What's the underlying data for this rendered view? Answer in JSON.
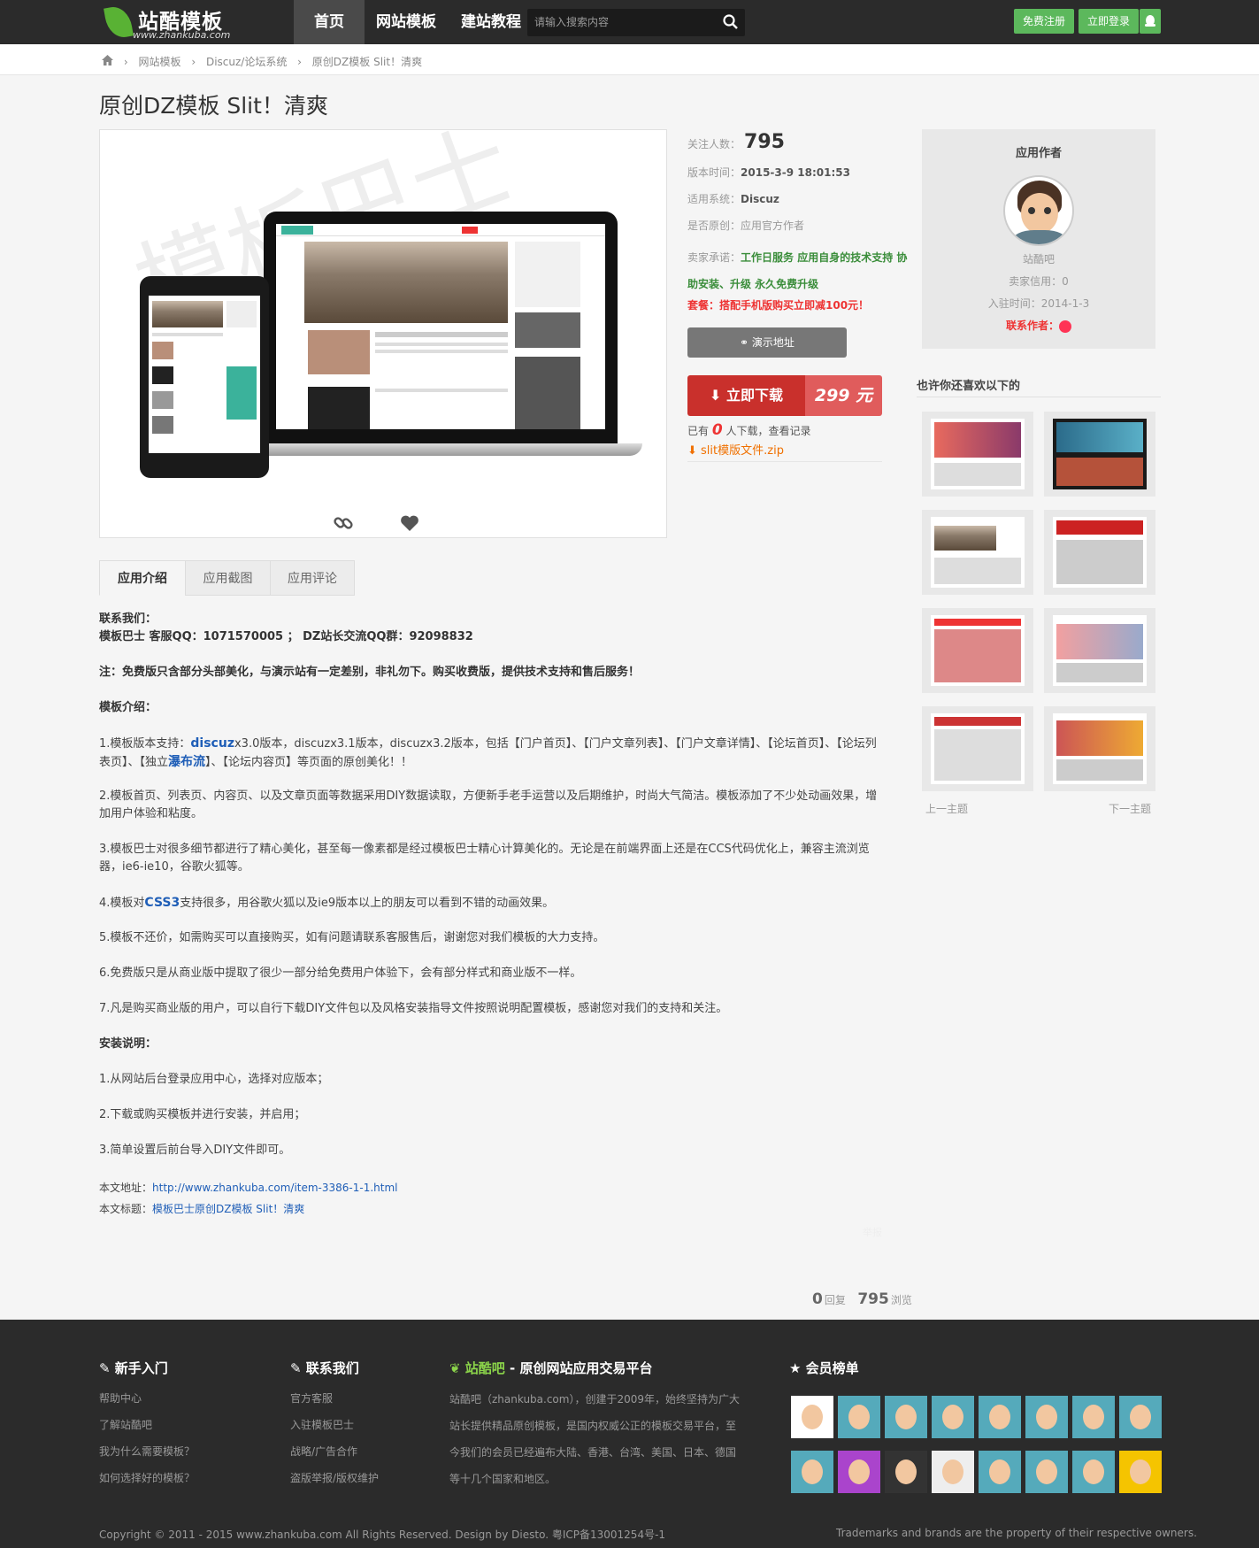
{
  "header": {
    "logo_text": "站酷模板",
    "logo_url": "www.zhankuba.com",
    "nav": [
      "首页",
      "网站模板",
      "建站教程"
    ],
    "search_placeholder": "请输入搜索内容",
    "register_label": "免费注册",
    "login_label": "立即登录"
  },
  "breadcrumb": [
    "网站模板",
    "Discuz/论坛系统",
    "原创DZ模板 Slit！清爽"
  ],
  "page_title": "原创DZ模板 Slit！清爽",
  "info": {
    "follow_label": "关注人数：",
    "follow_count": "795",
    "version_label": "版本时间：",
    "version_time": "2015-3-9 18:01:53",
    "system_label": "适用系统：",
    "system": "Discuz",
    "original_label": "是否原创：",
    "original": "应用官方作者",
    "promise_label": "卖家承诺：",
    "promise": "工作日服务 应用自身的技术支持 协助安装、升级 永久免费升级",
    "package": "套餐：搭配手机版购买立即减100元！",
    "demo_label": "演示地址",
    "download_label": "立即下载",
    "price": "299 元",
    "downloads_prefix": "已有",
    "downloads_count": "0",
    "downloads_suffix": "人下载，查看记录",
    "file_name": "slit模版文件.zip"
  },
  "author": {
    "heading": "应用作者",
    "name": "站酷吧",
    "credit": "卖家信用：0",
    "join": "入驻时间：2014-1-3",
    "contact": "联系作者："
  },
  "likes": {
    "heading": "也许你还喜欢以下的",
    "prev": "上一主题",
    "next": "下一主题"
  },
  "tabs": [
    "应用介绍",
    "应用截图",
    "应用评论"
  ],
  "content": {
    "contact_head": "联系我们：",
    "contact_qq": "模板巴士 客服QQ：1071570005 ； DZ站长交流QQ群：92098832",
    "note": "注：免费版只含部分头部美化，与演示站有一定差别，非礼勿下。购买收费版，提供技术支持和售后服务！",
    "intro_head": "模板介绍：",
    "p1_a": "1.模板版本支持：",
    "p1_link": "discuz",
    "p1_b": "x3.0版本，discuzx3.1版本，discuzx3.2版本，包括【门户首页】、【门户文章列表】、【门户文章详情】、【论坛首页】、【论坛列表页】、【独立",
    "p1_link2": "瀑布流",
    "p1_c": "】、【论坛内容页】等页面的原创美化！！",
    "p2": "2.模板首页、列表页、内容页、以及文章页面等数据采用DIY数据读取，方便新手老手运营以及后期维护，时尚大气简洁。模板添加了不少处动画效果，增加用户体验和粘度。",
    "p3": "3.模板巴士对很多细节都进行了精心美化，甚至每一像素都是经过模板巴士精心计算美化的。无论是在前端界面上还是在CCS代码优化上，兼容主流浏览器，ie6-ie10，谷歌火狐等。",
    "p4_a": "4.模板对",
    "p4_link": "CSS3",
    "p4_b": "支持很多，用谷歌火狐以及ie9版本以上的朋友可以看到不错的动画效果。",
    "p5": "5.模板不还价，如需购买可以直接购买，如有问题请联系客服售后，谢谢您对我们模板的大力支持。",
    "p6": "6.免费版只是从商业版中提取了很少一部分给免费用户体验下，会有部分样式和商业版不一样。",
    "p7": "7.凡是购买商业版的用户，可以自行下载DIY文件包以及风格安装指导文件按照说明配置模板，感谢您对我们的支持和关注。",
    "install_head": "安装说明：",
    "i1": "1.从网站后台登录应用中心，选择对应版本；",
    "i2": "2.下载或购买模板并进行安装，并启用；",
    "i3": "3.简单设置后前台导入DIY文件即可。",
    "addr_label": "本文地址：",
    "addr": "http://www.zhankuba.com/item-3386-1-1.html",
    "title_label": "本文标题：",
    "title_val": "模板巴士原创DZ模板 Slit！清爽",
    "report": "举报"
  },
  "stats": {
    "replies": "0",
    "replies_label": "回复",
    "views": "795",
    "views_label": "浏览"
  },
  "footer": {
    "col1_head": "新手入门",
    "col1": [
      "帮助中心",
      "了解站酷吧",
      "我为什么需要模板？",
      "如何选择好的模板？"
    ],
    "col2_head": "联系我们",
    "col2": [
      "官方客服",
      "入驻模板巴士",
      "战略/广告合作",
      "盗版举报/版权维护"
    ],
    "col3_brand": "站酷吧",
    "col3_head": " - 原创网站应用交易平台",
    "col3_text": "站酷吧（zhankuba.com），创建于2009年，始终坚持为广大站长提供精品原创模板，是国内权威公正的模板交易平台，至今我们的会员已经遍布大陆、香港、台湾、美国、日本、德国等十几个国家和地区。",
    "col4_head": "会员榜单",
    "copyright": "Copyright © 2011 - 2015 www.zhankuba.com All Rights Reserved. Design by Diesto. 粤ICP备13001254号-1",
    "trademark": "Trademarks and brands are the property of their respective owners."
  },
  "colors": {
    "green": "#5cb85c",
    "red": "#c9302c",
    "dark": "#2b2b2b"
  }
}
